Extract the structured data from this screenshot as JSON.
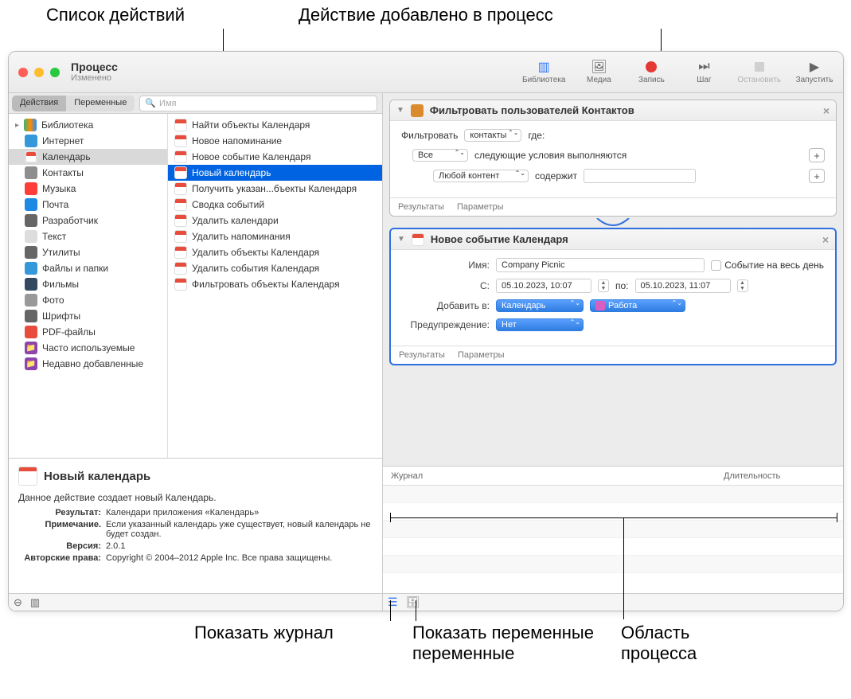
{
  "annotations": {
    "actions_list": "Список действий",
    "action_added": "Действие добавлено в процесс",
    "show_log": "Показать журнал",
    "show_vars": "Показать переменные",
    "workflow_area_l1": "Область",
    "workflow_area_l2": "процесса"
  },
  "window": {
    "title": "Процесс",
    "subtitle": "Изменено"
  },
  "toolbar": {
    "library": "Библиотека",
    "media": "Медиа",
    "record": "Запись",
    "step": "Шаг",
    "stop": "Остановить",
    "run": "Запустить"
  },
  "tabs": {
    "actions": "Действия",
    "variables": "Переменные"
  },
  "search": {
    "placeholder": "Имя",
    "icon_label": "Q"
  },
  "sidebar": {
    "library": "Библиотека",
    "items": [
      {
        "label": "Интернет",
        "color": "#3498db"
      },
      {
        "label": "Календарь",
        "color": "#fff",
        "sel": true
      },
      {
        "label": "Контакты",
        "color": "#8e8e8e"
      },
      {
        "label": "Музыка",
        "color": "#fc3d39"
      },
      {
        "label": "Почта",
        "color": "#1e88e5"
      },
      {
        "label": "Разработчик",
        "color": "#666"
      },
      {
        "label": "Текст",
        "color": "#ddd"
      },
      {
        "label": "Утилиты",
        "color": "#666"
      },
      {
        "label": "Файлы и папки",
        "color": "#3498db"
      },
      {
        "label": "Фильмы",
        "color": "#34495e"
      },
      {
        "label": "Фото",
        "color": "#999"
      },
      {
        "label": "Шрифты",
        "color": "#666"
      },
      {
        "label": "PDF-файлы",
        "color": "#e74c3c"
      }
    ],
    "recent": "Часто используемые",
    "added": "Недавно добавленные"
  },
  "actions": [
    "Найти объекты Календаря",
    "Новое напоминание",
    "Новое событие Календаря",
    "Новый календарь",
    "Получить указан...бъекты Календаря",
    "Сводка событий",
    "Удалить календари",
    "Удалить напоминания",
    "Удалить объекты Календаря",
    "Удалить события Календаря",
    "Фильтровать объекты Календаря"
  ],
  "actions_sel_index": 3,
  "desc": {
    "title": "Новый календарь",
    "text": "Данное действие создает новый Календарь.",
    "result_lbl": "Результат:",
    "result": "Календари приложения «Календарь»",
    "note_lbl": "Примечание.",
    "note": "Если указанный календарь уже существует, новый календарь не будет создан.",
    "version_lbl": "Версия:",
    "version": "2.0.1",
    "copyright_lbl": "Авторские права:",
    "copyright": "Copyright © 2004–2012 Apple Inc. Все права защищены."
  },
  "card1": {
    "title": "Фильтровать пользователей Контактов",
    "filter_lbl": "Фильтровать",
    "filter_val": "контакты",
    "where": "где:",
    "all": "Все",
    "cond": "следующие условия выполняются",
    "any": "Любой контент",
    "contains": "содержит",
    "results": "Результаты",
    "params": "Параметры"
  },
  "card2": {
    "title": "Новое событие Календаря",
    "name_lbl": "Имя:",
    "name_val": "Company Picnic",
    "allday": "Событие на весь день",
    "from_lbl": "С:",
    "from_val": "05.10.2023, 10:07",
    "to_lbl": "по:",
    "to_val": "05.10.2023, 11:07",
    "addto_lbl": "Добавить в:",
    "addto_val": "Календарь",
    "cal_val": "Работа",
    "alert_lbl": "Предупреждение:",
    "alert_val": "Нет",
    "results": "Результаты",
    "params": "Параметры"
  },
  "log": {
    "col1": "Журнал",
    "col2": "Длительность"
  }
}
